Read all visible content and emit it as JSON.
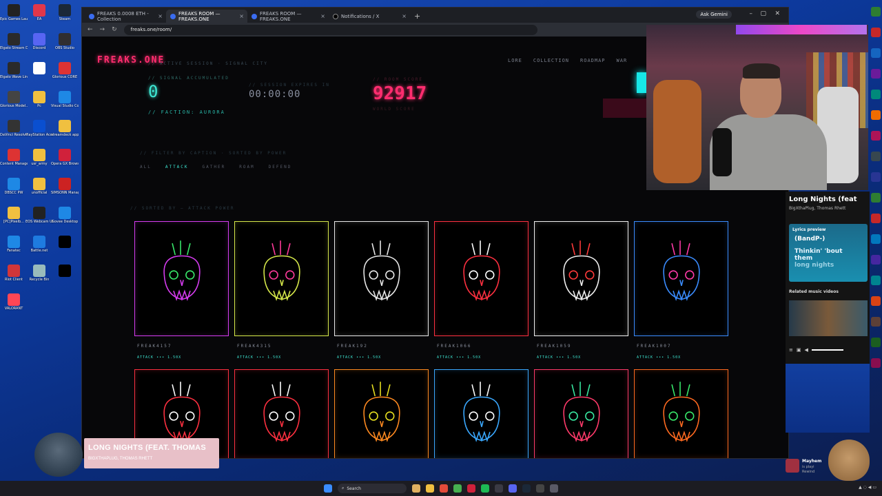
{
  "desktop": {
    "icons": [
      {
        "label": "Epic Games Launcher",
        "color": "#222"
      },
      {
        "label": "EA",
        "color": "#e0374a"
      },
      {
        "label": "Steam",
        "color": "#1b2838"
      },
      {
        "label": "Elgato Stream Deck",
        "color": "#2a2a2a"
      },
      {
        "label": "Discord",
        "color": "#5865f2"
      },
      {
        "label": "OBS Studio",
        "color": "#302e31"
      },
      {
        "label": "Elgato Wave Link",
        "color": "#2a2a2a"
      },
      {
        "label": "",
        "color": "#ffffff"
      },
      {
        "label": "Glorious CORE",
        "color": "#d33"
      },
      {
        "label": "Glorious Model...",
        "color": "#444"
      },
      {
        "label": "Pc",
        "color": "#f0c040"
      },
      {
        "label": "Visual Studio Code",
        "color": "#1e88e5"
      },
      {
        "label": "DaVinci Resolve",
        "color": "#333"
      },
      {
        "label": "PlayStation Accessories",
        "color": "#0a4fd0"
      },
      {
        "label": "streamdeck app",
        "color": "#f0c040"
      },
      {
        "label": "Content Manager",
        "color": "#d33"
      },
      {
        "label": "usr_army",
        "color": "#f0c040"
      },
      {
        "label": "Opera GX Browser",
        "color": "#d0213b"
      },
      {
        "label": "DBSCC PW",
        "color": "#1e88e5"
      },
      {
        "label": "unofficial",
        "color": "#f0c040"
      },
      {
        "label": "SIMSONN Manager",
        "color": "#c22"
      },
      {
        "label": "[PC]Pixelb...",
        "color": "#f0c040"
      },
      {
        "label": "EOS Webcam Utility Pro",
        "color": "#222"
      },
      {
        "label": "Govee Desktop",
        "color": "#1e88e5"
      },
      {
        "label": "Fanatec",
        "color": "#1e88e5"
      },
      {
        "label": "Battle.net",
        "color": "#1e7be0"
      },
      {
        "label": "",
        "color": "#000"
      },
      {
        "label": "Riot Client",
        "color": "#d13639"
      },
      {
        "label": "Recycle Bin",
        "color": "#9bb"
      },
      {
        "label": "",
        "color": "#000"
      },
      {
        "label": "VALORANT",
        "color": "#ff4655"
      }
    ]
  },
  "browser": {
    "tabs": [
      {
        "label": "FREAKS 0.0008 ETH - Collection",
        "icon": "tab-favicon",
        "active": false
      },
      {
        "label": "FREAKS ROOM — FREAKS.ONE",
        "icon": "tab-favicon",
        "active": true
      },
      {
        "label": "FREAKS ROOM — FREAKS.ONE",
        "icon": "tab-favicon",
        "active": false
      },
      {
        "label": "Notifications / X",
        "icon": "x-icon",
        "active": false
      }
    ],
    "new_tab": "+",
    "ask_gemini": "Ask Gemini",
    "url": "freaks.one/room/"
  },
  "page": {
    "brand": "FREAKS.ONE",
    "nav": [
      "LORE",
      "COLLECTION",
      "ROADMAP",
      "WAR"
    ],
    "session_label": "// ACTIVE SESSION · SIGNAL CITY",
    "signal_label": "// SIGNAL ACCUMULATED",
    "signal_value": "0",
    "timer_label": "// SESSION EXPIRES IN",
    "timer": "00:00:00",
    "score_label": "// ROOM SCORE",
    "score": "92917",
    "score_sub": "WORLD SCORE",
    "faction": "// FACTION: AURORA",
    "filter_heading": "// FILTER BY CAPTION · SORTED BY POWER",
    "filters": [
      "ALL",
      "ATTACK",
      "GATHER",
      "ROAM",
      "DEFEND"
    ],
    "active_filter": "ATTACK",
    "grid_heading": "// SORTED BY — ATTACK POWER",
    "cards_row1": [
      {
        "name": "FREAK4157",
        "power": "ATTACK ••• 1.50X",
        "color": "#d63cf0",
        "accent": "#38e86a"
      },
      {
        "name": "FREAK4315",
        "power": "ATTACK ••• 1.50X",
        "color": "#d6e84a",
        "accent": "#ff3a9a"
      },
      {
        "name": "FREAK192",
        "power": "ATTACK ••• 1.50X",
        "color": "#e8e8e8",
        "accent": "#e8e8e8"
      },
      {
        "name": "FREAK1066",
        "power": "ATTACK ••• 1.50X",
        "color": "#ff3040",
        "accent": "#ffffff"
      },
      {
        "name": "FREAK1059",
        "power": "ATTACK ••• 1.50X",
        "color": "#f0f0f0",
        "accent": "#ff3a3a"
      },
      {
        "name": "FREAK1007",
        "power": "ATTACK ••• 1.50X",
        "color": "#3a8cff",
        "accent": "#ff3aa8"
      }
    ],
    "cards_row2": [
      {
        "color": "#ff3040",
        "accent": "#ffffff"
      },
      {
        "color": "#ff3040",
        "accent": "#ffffff"
      },
      {
        "color": "#ff8a20",
        "accent": "#e8e020"
      },
      {
        "color": "#3aa8ff",
        "accent": "#ffffff"
      },
      {
        "color": "#ff3a6a",
        "accent": "#38e8a0"
      },
      {
        "color": "#ff6a20",
        "accent": "#38e86a"
      }
    ]
  },
  "music_panel": {
    "title": "Long Nights (feat",
    "artist": "BigXthaPlug, Thomas Rhett",
    "lyrics_preview": "Lyrics preview",
    "line1": "(BandP-)",
    "line2": "Thinkin' 'bout them",
    "line3": "long nights",
    "related": "Related music videos"
  },
  "now_playing": {
    "title": "LONG NIGHTS (FEAT. THOMAS",
    "artist": "BIGXTHAPLUG, THOMAS RHETT"
  },
  "notification": {
    "title": "Mayhem",
    "sub1": "is playi",
    "sub2": "Rewind"
  },
  "taskbar": {
    "search": "Search"
  }
}
